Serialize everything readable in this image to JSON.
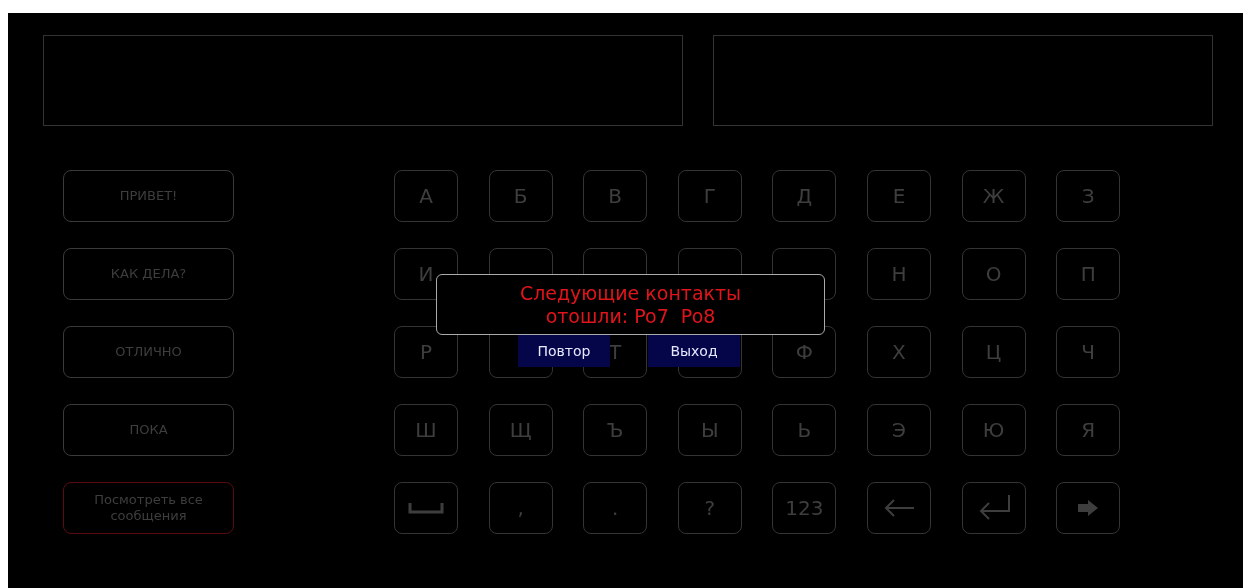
{
  "displays": [
    {
      "kind": "wide"
    },
    {
      "kind": "narrow"
    }
  ],
  "phrases": [
    {
      "label": "ПРИВЕТ!",
      "highlighted": false
    },
    {
      "label": "КАК ДЕЛА?",
      "highlighted": false
    },
    {
      "label": "ОТЛИЧНО",
      "highlighted": false
    },
    {
      "label": "ПОКА",
      "highlighted": false
    },
    {
      "label": "Посмотреть все сообщения",
      "highlighted": true
    }
  ],
  "keys": [
    [
      {
        "kind": "char",
        "label": "А"
      },
      {
        "kind": "char",
        "label": "Б"
      },
      {
        "kind": "char",
        "label": "В"
      },
      {
        "kind": "char",
        "label": "Г"
      },
      {
        "kind": "char",
        "label": "Д"
      },
      {
        "kind": "char",
        "label": "Е"
      },
      {
        "kind": "char",
        "label": "Ж"
      },
      {
        "kind": "char",
        "label": "З"
      }
    ],
    [
      {
        "kind": "char",
        "label": "И"
      },
      {
        "kind": "blank"
      },
      {
        "kind": "blank"
      },
      {
        "kind": "blank"
      },
      {
        "kind": "blank"
      },
      {
        "kind": "char",
        "label": "Н"
      },
      {
        "kind": "char",
        "label": "О"
      },
      {
        "kind": "char",
        "label": "П"
      }
    ],
    [
      {
        "kind": "char",
        "label": "Р"
      },
      {
        "kind": "blank"
      },
      {
        "kind": "char",
        "label": "Т"
      },
      {
        "kind": "blank"
      },
      {
        "kind": "char",
        "label": "Ф"
      },
      {
        "kind": "char",
        "label": "Х"
      },
      {
        "kind": "char",
        "label": "Ц"
      },
      {
        "kind": "char",
        "label": "Ч"
      }
    ],
    [
      {
        "kind": "char",
        "label": "Ш"
      },
      {
        "kind": "char",
        "label": "Щ"
      },
      {
        "kind": "char",
        "label": "Ъ"
      },
      {
        "kind": "char",
        "label": "Ы"
      },
      {
        "kind": "char",
        "label": "Ь"
      },
      {
        "kind": "char",
        "label": "Э"
      },
      {
        "kind": "char",
        "label": "Ю"
      },
      {
        "kind": "char",
        "label": "Я"
      }
    ],
    [
      {
        "kind": "space"
      },
      {
        "kind": "char",
        "label": ","
      },
      {
        "kind": "char",
        "label": "."
      },
      {
        "kind": "char",
        "label": "?"
      },
      {
        "kind": "char",
        "label": "123"
      },
      {
        "kind": "backspace"
      },
      {
        "kind": "enter"
      },
      {
        "kind": "next"
      }
    ]
  ],
  "dialog": {
    "message": "Следующие контакты отошли: Po7  Po8",
    "buttons": [
      "Повтор",
      "Выход"
    ]
  }
}
